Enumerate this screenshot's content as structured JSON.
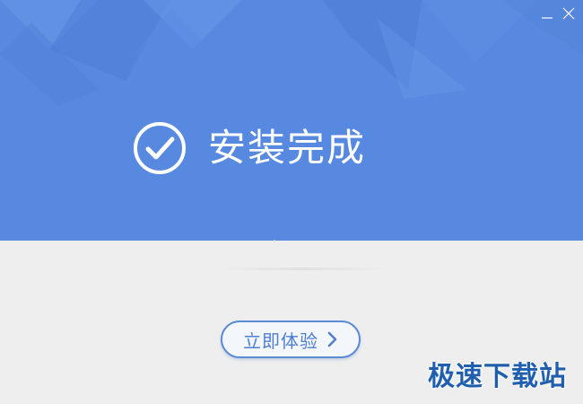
{
  "window": {
    "minimize_icon": "minimize-icon",
    "close_icon": "close-icon"
  },
  "header": {
    "title": "安装完成",
    "status_icon": "checkmark-circle-icon"
  },
  "action": {
    "label": "立即体验",
    "icon": "chevron-right-icon"
  },
  "watermark": "极速下载站",
  "colors": {
    "header_bg": "#5889e0",
    "body_bg": "#eeeeee",
    "accent": "#5b8ad6",
    "watermark": "#1f5fae"
  }
}
